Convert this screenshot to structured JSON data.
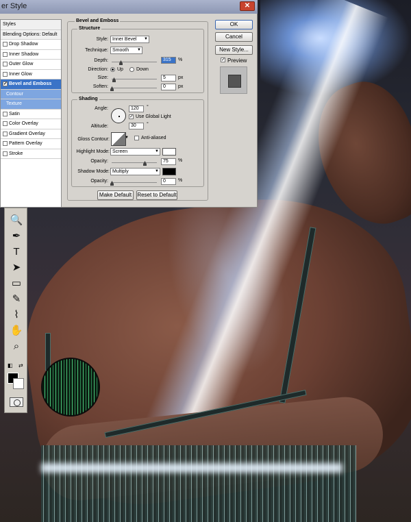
{
  "dialog": {
    "title": "er Style",
    "close": "✕"
  },
  "styles_list": {
    "header": "Styles",
    "blending": "Blending Options: Default",
    "items": [
      {
        "label": "Drop Shadow",
        "checked": false
      },
      {
        "label": "Inner Shadow",
        "checked": false
      },
      {
        "label": "Outer Glow",
        "checked": false
      },
      {
        "label": "Inner Glow",
        "checked": false
      },
      {
        "label": "Bevel and Emboss",
        "checked": true
      },
      {
        "label": "Contour",
        "checked": false
      },
      {
        "label": "Texture",
        "checked": false
      },
      {
        "label": "Satin",
        "checked": false
      },
      {
        "label": "Color Overlay",
        "checked": false
      },
      {
        "label": "Gradient Overlay",
        "checked": false
      },
      {
        "label": "Pattern Overlay",
        "checked": false
      },
      {
        "label": "Stroke",
        "checked": false
      }
    ]
  },
  "bevel": {
    "section_title": "Bevel and Emboss",
    "structure_title": "Structure",
    "style_label": "Style:",
    "style_value": "Inner Bevel",
    "technique_label": "Technique:",
    "technique_value": "Smooth",
    "depth_label": "Depth:",
    "depth_value": "315",
    "depth_unit": "%",
    "direction_label": "Direction:",
    "dir_up": "Up",
    "dir_down": "Down",
    "size_label": "Size:",
    "size_value": "5",
    "size_unit": "px",
    "soften_label": "Soften:",
    "soften_value": "0",
    "soften_unit": "px"
  },
  "shading": {
    "title": "Shading",
    "angle_label": "Angle:",
    "angle_value": "120",
    "angle_unit": "°",
    "global_light": "Use Global Light",
    "altitude_label": "Altitude:",
    "altitude_value": "30",
    "altitude_unit": "°",
    "gloss_label": "Gloss Contour:",
    "anti_aliased": "Anti-aliased",
    "highlight_label": "Highlight Mode:",
    "highlight_value": "Screen",
    "highlight_color": "#ffffff",
    "h_opacity_label": "Opacity:",
    "h_opacity_value": "75",
    "h_opacity_unit": "%",
    "shadow_label": "Shadow Mode:",
    "shadow_value": "Multiply",
    "shadow_color": "#000000",
    "s_opacity_label": "Opacity:",
    "s_opacity_value": "0",
    "s_opacity_unit": "%"
  },
  "buttons": {
    "ok": "OK",
    "cancel": "Cancel",
    "new_style": "New Style...",
    "preview": "Preview",
    "make_default": "Make Default",
    "reset_default": "Reset to Default"
  },
  "tools": [
    {
      "icon": "zoom-icon",
      "glyph": "🔍"
    },
    {
      "icon": "pen-icon",
      "glyph": "✒"
    },
    {
      "icon": "type-icon",
      "glyph": "T"
    },
    {
      "icon": "path-selection-icon",
      "glyph": "➤"
    },
    {
      "icon": "rectangle-shape-icon",
      "glyph": "▭"
    },
    {
      "icon": "notes-icon",
      "glyph": "✎"
    },
    {
      "icon": "eyedropper-icon",
      "glyph": "⌇"
    },
    {
      "icon": "hand-icon",
      "glyph": "✋"
    },
    {
      "icon": "zoom-tool-icon",
      "glyph": "⌕"
    }
  ]
}
